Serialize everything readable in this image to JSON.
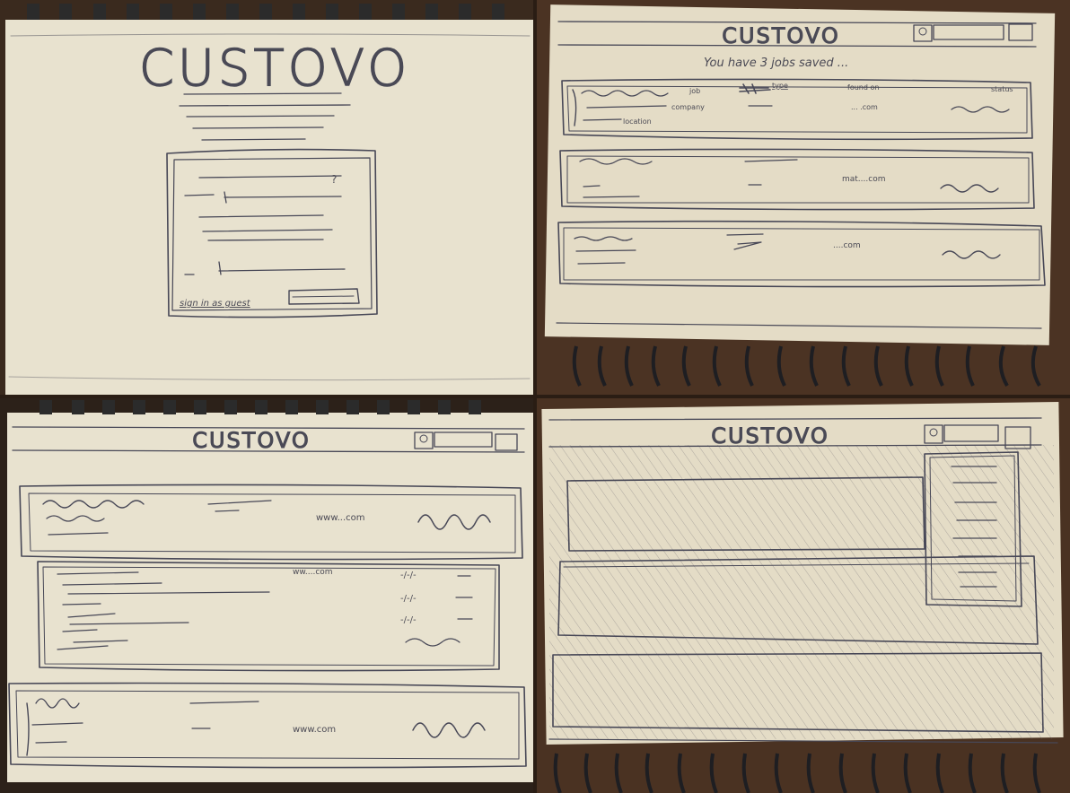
{
  "brand": "CUSTOVO",
  "login_sketch": {
    "field_marker": "?",
    "guest_link": "sign in as guest"
  },
  "saved_sketch": {
    "banner": "You have 3 jobs saved ...",
    "first_card": {
      "job_label": "job",
      "company_label": "company",
      "location_label": "location",
      "type_label": "type",
      "found_label": "found on",
      "found_value": "... .com",
      "status_label": "status"
    },
    "second_card": {
      "found_value": "mat....com"
    },
    "third_card": {
      "found_value": "....com"
    }
  },
  "detail_sketch": {
    "first_card": {
      "found_value": "www...com"
    },
    "expanded": {
      "found_value": "ww....com",
      "dates": [
        "-/-/-",
        "-/-/-",
        "-/-/-"
      ]
    },
    "third_card": {
      "found_value": "www.com"
    }
  },
  "menu_sketch": {
    "menu_items_count": 8
  },
  "colors": {
    "paper": "#e8e2cf",
    "ink": "#474756",
    "desk": "#4b3323"
  }
}
